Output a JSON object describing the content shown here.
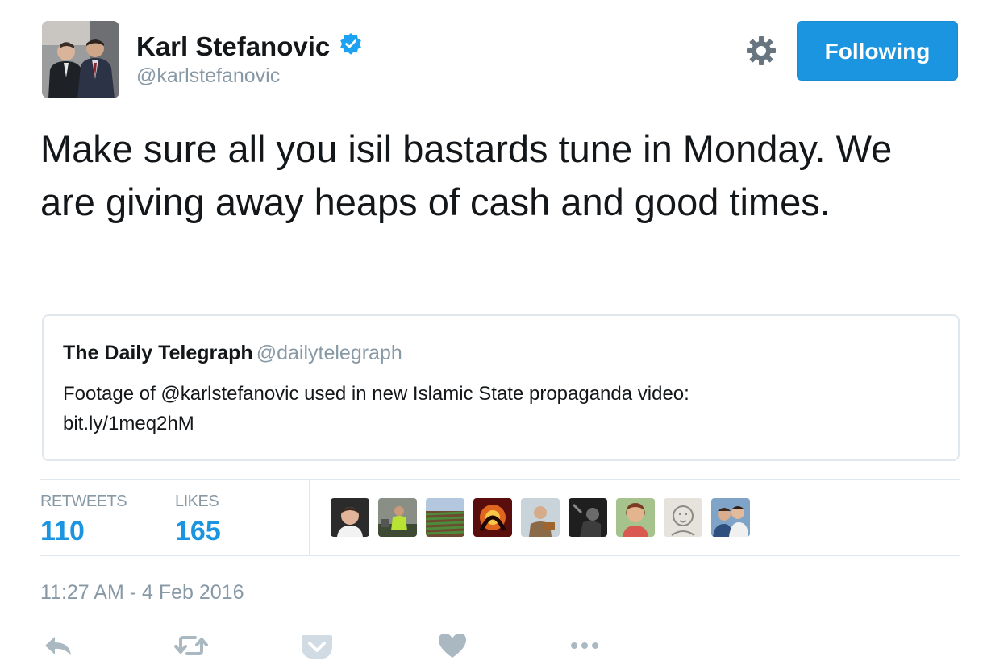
{
  "author": {
    "name": "Karl Stefanovic",
    "handle": "@karlstefanovic",
    "verified": true
  },
  "header": {
    "follow_label": "Following",
    "settings_icon": "gear-icon"
  },
  "tweet": {
    "text": "Make sure all you isil bastards tune in Monday. We are giving away heaps of cash and good times."
  },
  "quoted_tweet": {
    "name": "The Daily Telegraph",
    "handle": "@dailytelegraph",
    "text_line1": "Footage of @karlstefanovic used in new Islamic State propaganda video:",
    "text_line2": "bit.ly/1meq2hM"
  },
  "stats": {
    "retweets_label": "RETWEETS",
    "retweets_count": "110",
    "likes_label": "LIKES",
    "likes_count": "165"
  },
  "timestamp": "11:27 AM - 4 Feb 2016",
  "actions": [
    "reply-icon",
    "retweet-icon",
    "pocket-icon",
    "like-icon",
    "more-icon"
  ],
  "colors": {
    "accent": "#1b95e0",
    "secondary_text": "#8899a6",
    "border": "#e1e8ed",
    "verified": "#1da1f2"
  }
}
